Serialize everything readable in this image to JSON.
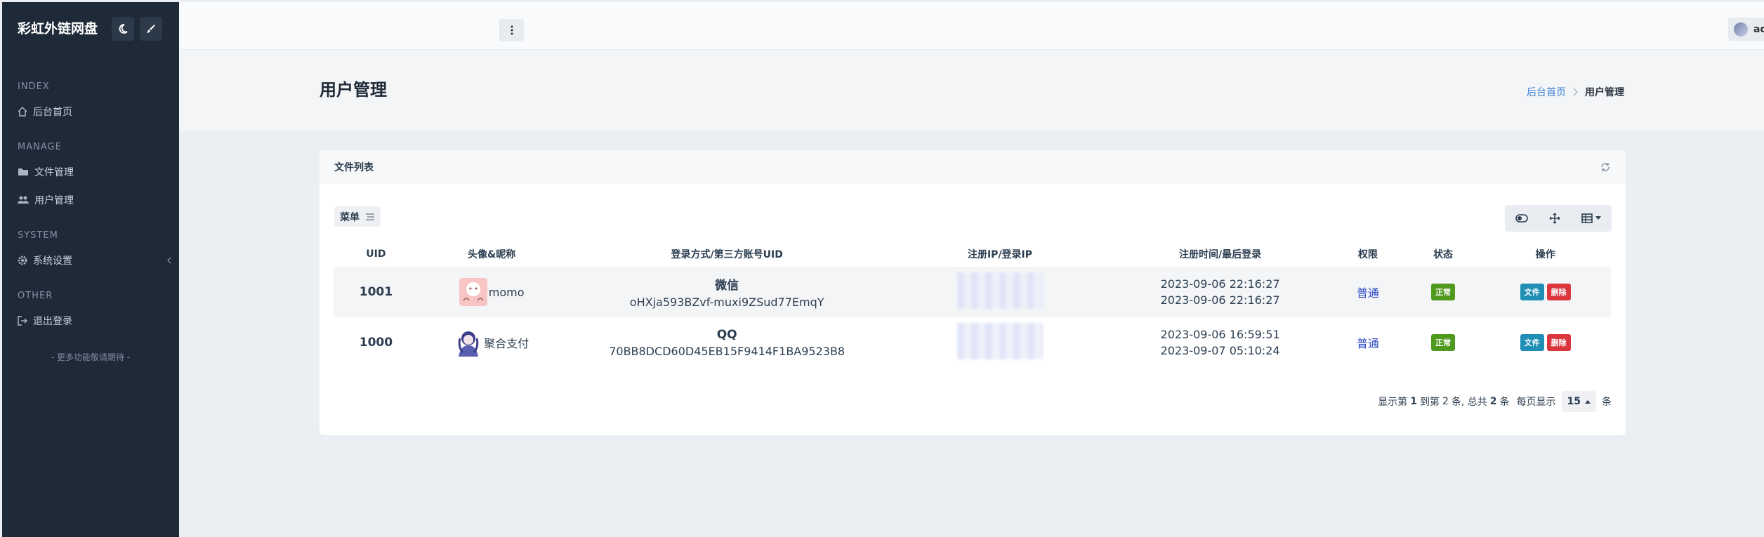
{
  "sidebar": {
    "brand": "彩虹外链网盘",
    "sections": [
      {
        "title": "INDEX",
        "items": [
          {
            "label": "后台首页",
            "icon": "home-icon"
          }
        ]
      },
      {
        "title": "MANAGE",
        "items": [
          {
            "label": "文件管理",
            "icon": "folder-icon"
          },
          {
            "label": "用户管理",
            "icon": "users-icon"
          }
        ]
      },
      {
        "title": "SYSTEM",
        "items": [
          {
            "label": "系统设置",
            "icon": "gear-icon"
          }
        ]
      },
      {
        "title": "OTHER",
        "items": [
          {
            "label": "退出登录",
            "icon": "logout-icon"
          }
        ]
      }
    ],
    "more": "- 更多功能敬请期待 -"
  },
  "header": {
    "user": "admin"
  },
  "hero": {
    "title": "用户管理",
    "breadcrumb": [
      "后台首页",
      "用户管理"
    ]
  },
  "card": {
    "title": "文件列表",
    "menu_label": "菜单",
    "columns": [
      "UID",
      "头像&昵称",
      "登录方式/第三方账号UID",
      "注册IP/登录IP",
      "注册时间/最后登录",
      "权限",
      "状态",
      "操作"
    ],
    "rows": [
      {
        "uid": "1001",
        "nick": "momo",
        "login_type": "微信",
        "login_uid": "oHXja593BZvf-muxi9ZSud77EmqY",
        "reg_time": "2023-09-06 22:16:27",
        "last_login": "2023-09-06 22:16:27",
        "level": "普通",
        "status": "正常",
        "btn_file": "文件",
        "btn_del": "删除"
      },
      {
        "uid": "1000",
        "nick": "聚合支付",
        "login_type": "QQ",
        "login_uid": "70BB8DCD60D45EB15F9414F1BA9523B8",
        "reg_time": "2023-09-06 16:59:51",
        "last_login": "2023-09-07 05:10:24",
        "level": "普通",
        "status": "正常",
        "btn_file": "文件",
        "btn_del": "删除"
      }
    ],
    "pagination": {
      "p1": "显示第",
      "from": "1",
      "p2": "到第",
      "to": "2",
      "p3": "条, 总共",
      "total": "2",
      "p4": "条",
      "p5": "每页显示",
      "size": "15",
      "p6": "条"
    }
  }
}
